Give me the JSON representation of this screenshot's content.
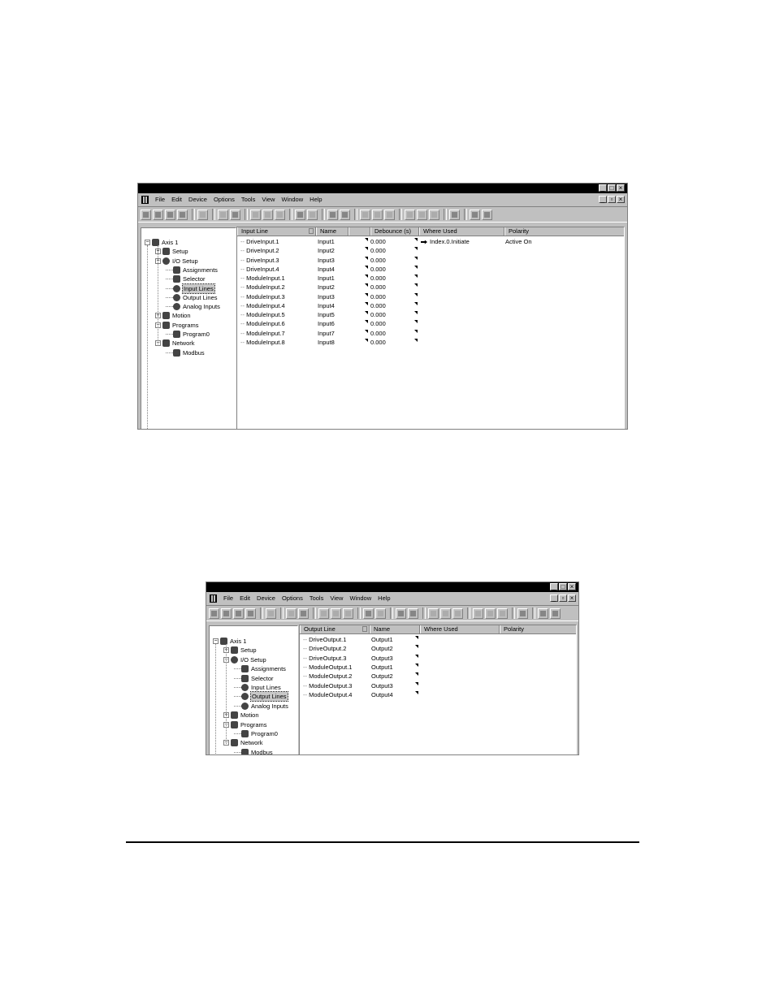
{
  "window1": {
    "menu": [
      "File",
      "Edit",
      "Device",
      "Options",
      "Tools",
      "View",
      "Window",
      "Help"
    ],
    "title_buttons": [
      "_",
      "□",
      "×"
    ],
    "mdi_buttons": [
      "_",
      "▫",
      "×"
    ],
    "tree": [
      {
        "label": "Axis 1",
        "icon": "drive-icon",
        "expander": "−"
      },
      {
        "label": "Setup",
        "icon": "setup-icon",
        "expander": "+"
      },
      {
        "label": "I/O Setup",
        "icon": "io-setup-icon",
        "expander": "−"
      },
      {
        "label": "Assignments",
        "icon": "assignments-icon",
        "expander": ""
      },
      {
        "label": "Selector",
        "icon": "selector-icon",
        "expander": ""
      },
      {
        "label": "Input Lines",
        "icon": "input-lines-icon",
        "expander": "",
        "selected": true
      },
      {
        "label": "Output Lines",
        "icon": "output-lines-icon",
        "expander": ""
      },
      {
        "label": "Analog Inputs",
        "icon": "analog-inputs-icon",
        "expander": ""
      },
      {
        "label": "Motion",
        "icon": "motion-icon",
        "expander": "+"
      },
      {
        "label": "Programs",
        "icon": "programs-icon",
        "expander": "−"
      },
      {
        "label": "Program0",
        "icon": "program-icon",
        "expander": ""
      },
      {
        "label": "Network",
        "icon": "network-icon",
        "expander": "−"
      },
      {
        "label": "Modbus",
        "icon": "modbus-icon",
        "expander": ""
      }
    ],
    "columns": [
      "Input Line",
      "Name",
      "Debounce (s)",
      "Where Used",
      "Polarity"
    ],
    "rows": [
      {
        "line": "DriveInput.1",
        "name": "Input1",
        "debounce": "0.000",
        "where": "Index.0.Initiate",
        "polarity": "Active On"
      },
      {
        "line": "DriveInput.2",
        "name": "Input2",
        "debounce": "0.000",
        "where": "",
        "polarity": ""
      },
      {
        "line": "DriveInput.3",
        "name": "Input3",
        "debounce": "0.000",
        "where": "",
        "polarity": ""
      },
      {
        "line": "DriveInput.4",
        "name": "Input4",
        "debounce": "0.000",
        "where": "",
        "polarity": ""
      },
      {
        "line": "ModuleInput.1",
        "name": "Input1",
        "debounce": "0.000",
        "where": "",
        "polarity": ""
      },
      {
        "line": "ModuleInput.2",
        "name": "Input2",
        "debounce": "0.000",
        "where": "",
        "polarity": ""
      },
      {
        "line": "ModuleInput.3",
        "name": "Input3",
        "debounce": "0.000",
        "where": "",
        "polarity": ""
      },
      {
        "line": "ModuleInput.4",
        "name": "Input4",
        "debounce": "0.000",
        "where": "",
        "polarity": ""
      },
      {
        "line": "ModuleInput.5",
        "name": "Input5",
        "debounce": "0.000",
        "where": "",
        "polarity": ""
      },
      {
        "line": "ModuleInput.6",
        "name": "Input6",
        "debounce": "0.000",
        "where": "",
        "polarity": ""
      },
      {
        "line": "ModuleInput.7",
        "name": "Input7",
        "debounce": "0.000",
        "where": "",
        "polarity": ""
      },
      {
        "line": "ModuleInput.8",
        "name": "Input8",
        "debounce": "0.000",
        "where": "",
        "polarity": ""
      }
    ]
  },
  "window2": {
    "menu": [
      "File",
      "Edit",
      "Device",
      "Options",
      "Tools",
      "View",
      "Window",
      "Help"
    ],
    "title_buttons": [
      "_",
      "□",
      "×"
    ],
    "mdi_buttons": [
      "_",
      "▫",
      "×"
    ],
    "tree": [
      {
        "label": "Axis 1",
        "icon": "drive-icon",
        "expander": "−"
      },
      {
        "label": "Setup",
        "icon": "setup-icon",
        "expander": "+"
      },
      {
        "label": "I/O Setup",
        "icon": "io-setup-icon",
        "expander": "−"
      },
      {
        "label": "Assignments",
        "icon": "assignments-icon",
        "expander": ""
      },
      {
        "label": "Selector",
        "icon": "selector-icon",
        "expander": ""
      },
      {
        "label": "Input Lines",
        "icon": "input-lines-icon",
        "expander": ""
      },
      {
        "label": "Output Lines",
        "icon": "output-lines-icon",
        "expander": "",
        "selected": true
      },
      {
        "label": "Analog Inputs",
        "icon": "analog-inputs-icon",
        "expander": ""
      },
      {
        "label": "Motion",
        "icon": "motion-icon",
        "expander": "+"
      },
      {
        "label": "Programs",
        "icon": "programs-icon",
        "expander": "−"
      },
      {
        "label": "Program0",
        "icon": "program-icon",
        "expander": ""
      },
      {
        "label": "Network",
        "icon": "network-icon",
        "expander": "−"
      },
      {
        "label": "Modbus",
        "icon": "modbus-icon",
        "expander": ""
      }
    ],
    "columns": [
      "Output Line",
      "Name",
      "Where Used",
      "Polarity"
    ],
    "rows": [
      {
        "line": "DriveOutput.1",
        "name": "Output1"
      },
      {
        "line": "DriveOutput.2",
        "name": "Output2"
      },
      {
        "line": "DriveOutput.3",
        "name": "Output3"
      },
      {
        "line": "ModuleOutput.1",
        "name": "Output1"
      },
      {
        "line": "ModuleOutput.2",
        "name": "Output2"
      },
      {
        "line": "ModuleOutput.3",
        "name": "Output3"
      },
      {
        "line": "ModuleOutput.4",
        "name": "Output4"
      }
    ]
  }
}
